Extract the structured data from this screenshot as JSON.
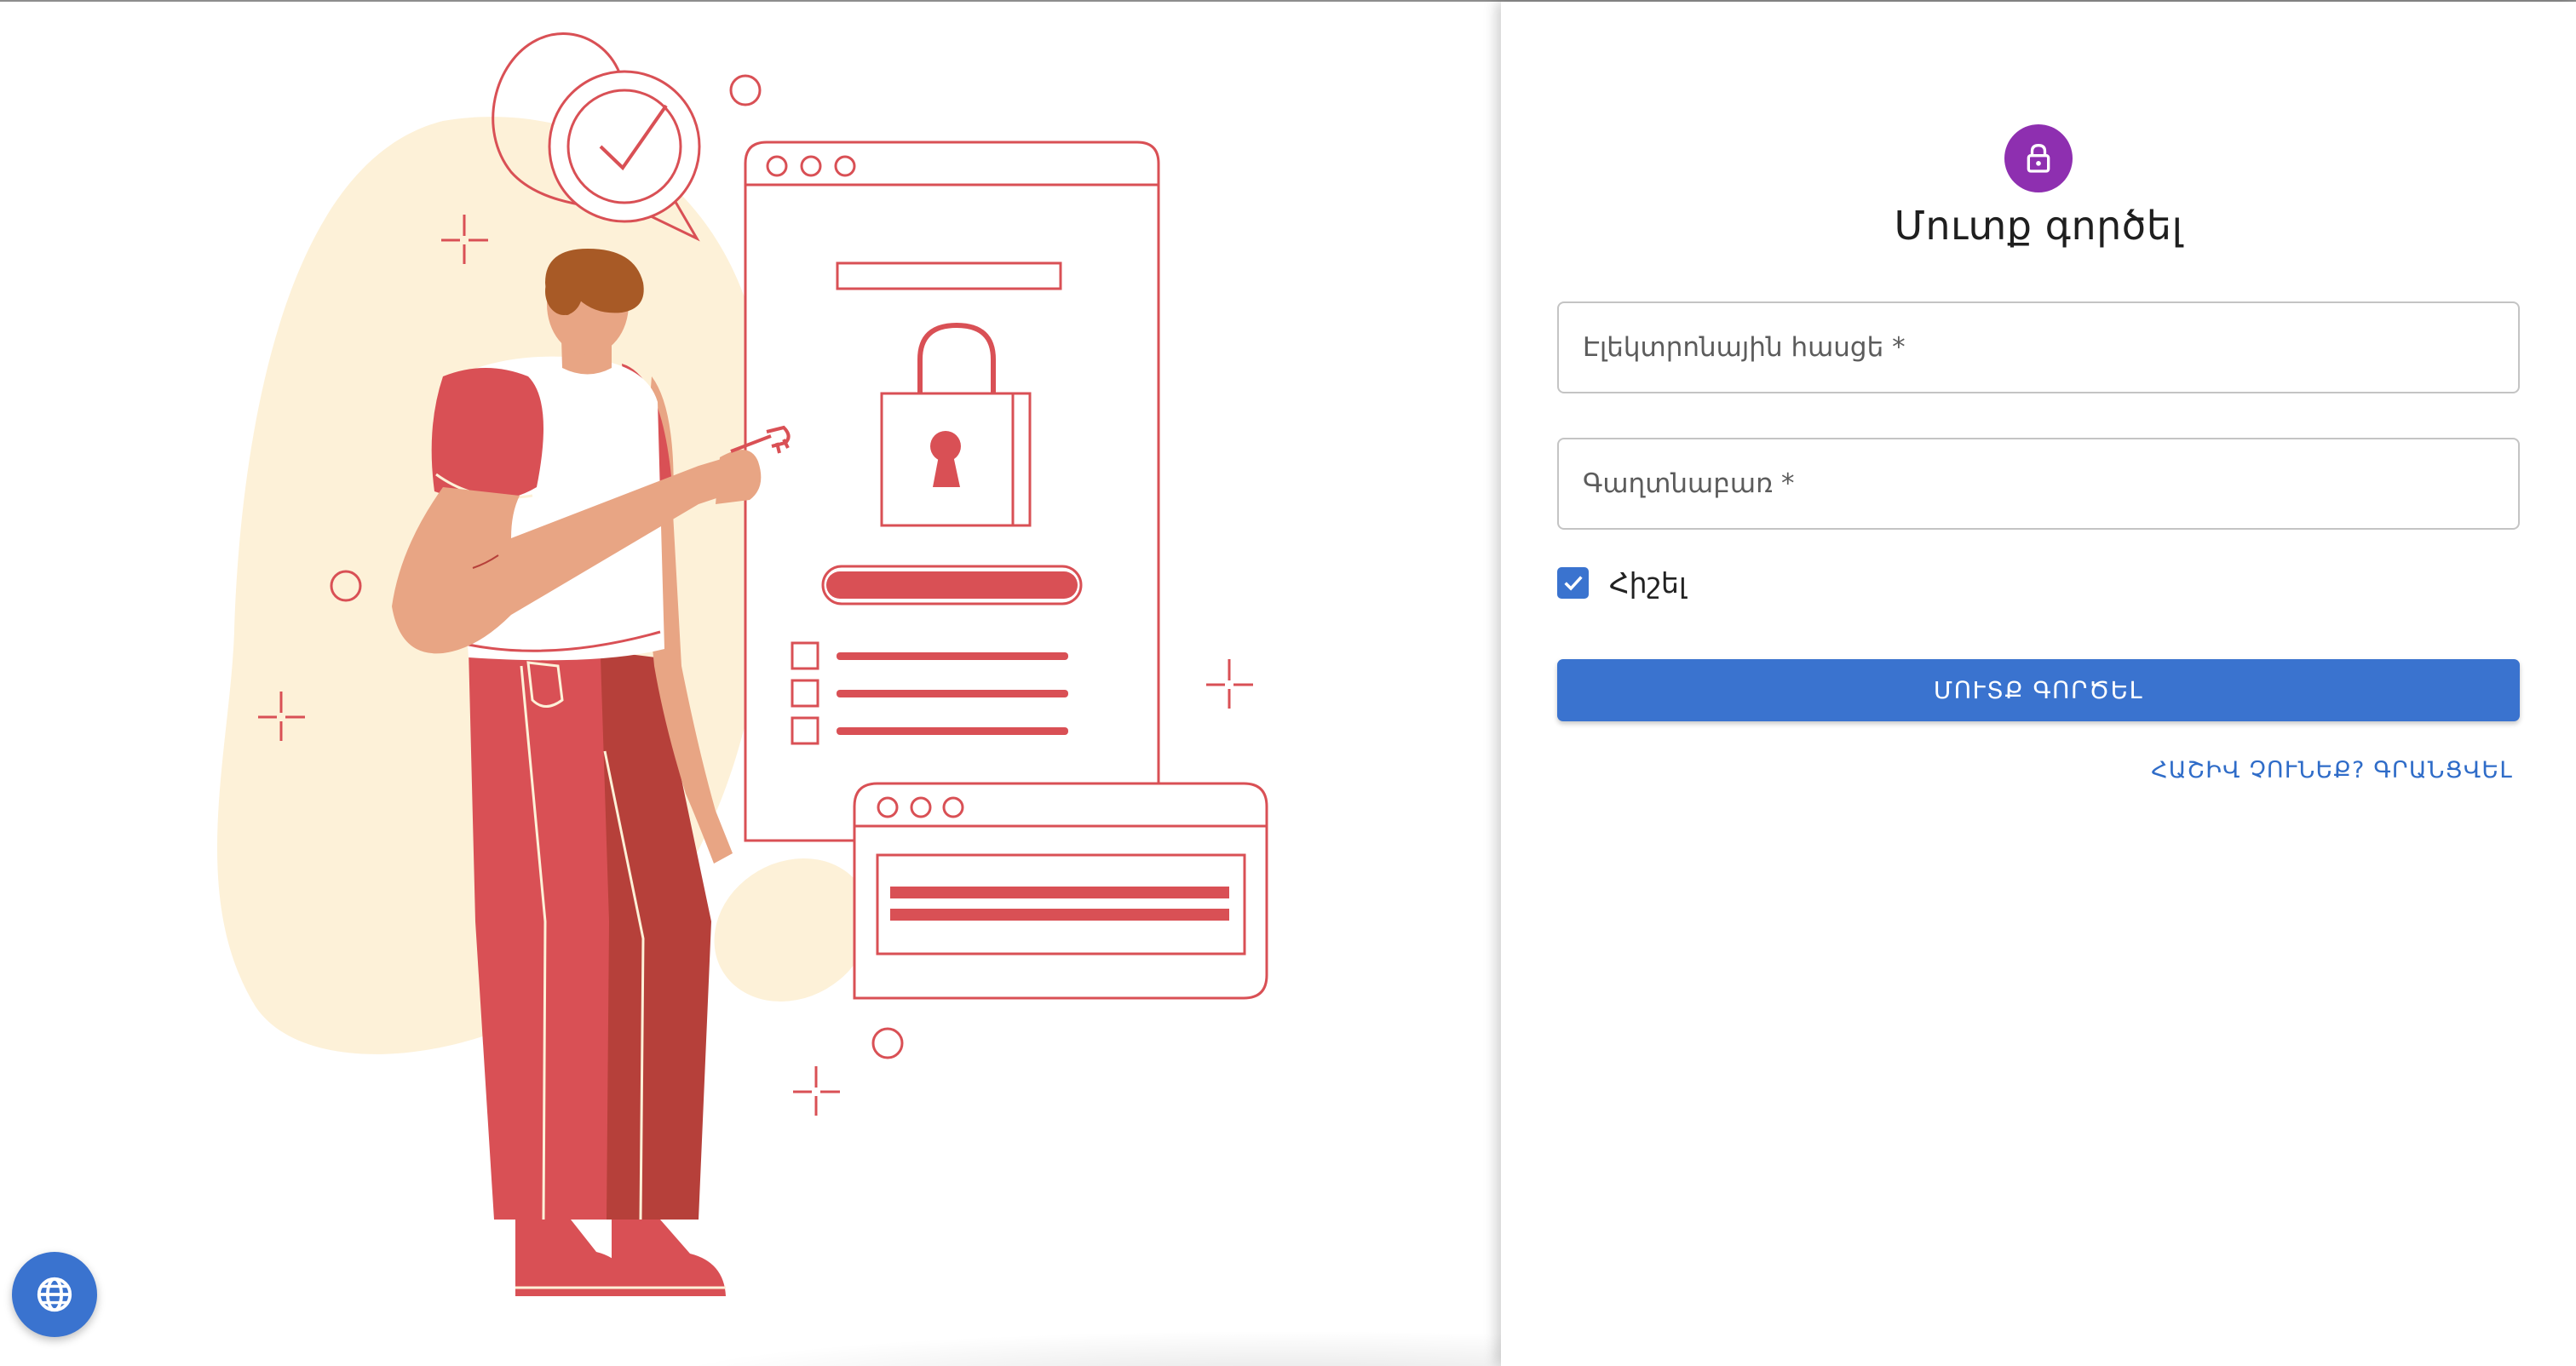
{
  "login": {
    "title": "Մուտք գործել",
    "email": {
      "placeholder": "Էլեկտրոնային հասցե *",
      "value": ""
    },
    "password": {
      "placeholder": "Գաղտնաբառ *",
      "value": ""
    },
    "remember": {
      "label": "Հիշել",
      "checked": true
    },
    "submit_label": "ՄՈՒՏՔ ԳՈՐԾԵԼ",
    "register_link": "ՀԱՇԻՎ ՉՈՒՆԵՔ? ԳՐԱՆՑՎԵԼ"
  },
  "icons": {
    "avatar": "lock-icon",
    "language": "globe-icon",
    "checkbox": "checkmark-icon"
  },
  "colors": {
    "primary": "#3a73cf",
    "avatar": "#8e2fb0",
    "illustration_red": "#d95055",
    "illustration_bg": "#fdf1d8"
  }
}
